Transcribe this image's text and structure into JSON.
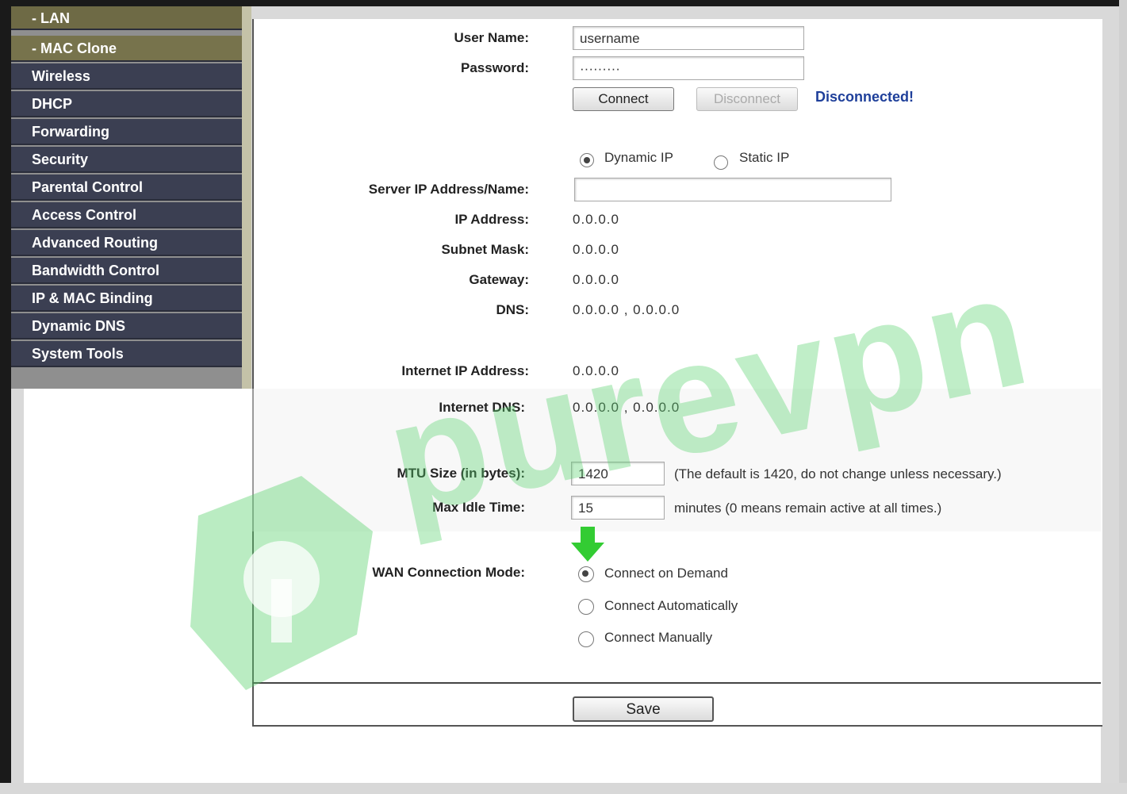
{
  "sidebar": {
    "items": [
      {
        "label": "- LAN",
        "sub": true
      },
      {
        "label": "- MAC Clone",
        "sub": true
      },
      {
        "label": "Wireless",
        "sub": false
      },
      {
        "label": "DHCP",
        "sub": false
      },
      {
        "label": "Forwarding",
        "sub": false
      },
      {
        "label": "Security",
        "sub": false
      },
      {
        "label": "Parental Control",
        "sub": false
      },
      {
        "label": "Access Control",
        "sub": false
      },
      {
        "label": "Advanced Routing",
        "sub": false
      },
      {
        "label": "Bandwidth Control",
        "sub": false
      },
      {
        "label": "IP & MAC Binding",
        "sub": false
      },
      {
        "label": "Dynamic DNS",
        "sub": false
      },
      {
        "label": "System Tools",
        "sub": false
      }
    ]
  },
  "form": {
    "user_name_label": "User Name:",
    "user_name_value": "username",
    "password_label": "Password:",
    "password_value": "·········",
    "connect_label": "Connect",
    "disconnect_label": "Disconnect",
    "status_text": "Disconnected!",
    "dynamic_ip_label": "Dynamic IP",
    "static_ip_label": "Static IP",
    "server_ip_label": "Server IP Address/Name:",
    "server_ip_value": "",
    "ip_address_label": "IP Address:",
    "ip_address_value": "0.0.0.0",
    "subnet_mask_label": "Subnet Mask:",
    "subnet_mask_value": "0.0.0.0",
    "gateway_label": "Gateway:",
    "gateway_value": "0.0.0.0",
    "dns_label": "DNS:",
    "dns_value": "0.0.0.0 , 0.0.0.0",
    "internet_ip_label": "Internet IP Address:",
    "internet_ip_value": "0.0.0.0",
    "internet_dns_label": "Internet DNS:",
    "internet_dns_value": "0.0.0.0 , 0.0.0.0",
    "mtu_label": "MTU Size (in bytes):",
    "mtu_value": "1420",
    "mtu_hint": "(The default is 1420, do not change unless necessary.)",
    "idle_label": "Max Idle Time:",
    "idle_value": "15",
    "idle_hint": "minutes (0 means remain active at all times.)",
    "wan_mode_label": "WAN Connection Mode:",
    "wan_modes": [
      "Connect on Demand",
      "Connect Automatically",
      "Connect Manually"
    ],
    "wan_selected": "Connect on Demand",
    "save_label": "Save"
  },
  "watermark": {
    "text": "purevpn",
    "color": "#5ad26e"
  },
  "colors": {
    "sidebar_bg": "#3b3f52",
    "sidebar_sub_bg": "#6e6a45",
    "status": "#1e3f9a",
    "arrow": "#33cc33"
  }
}
